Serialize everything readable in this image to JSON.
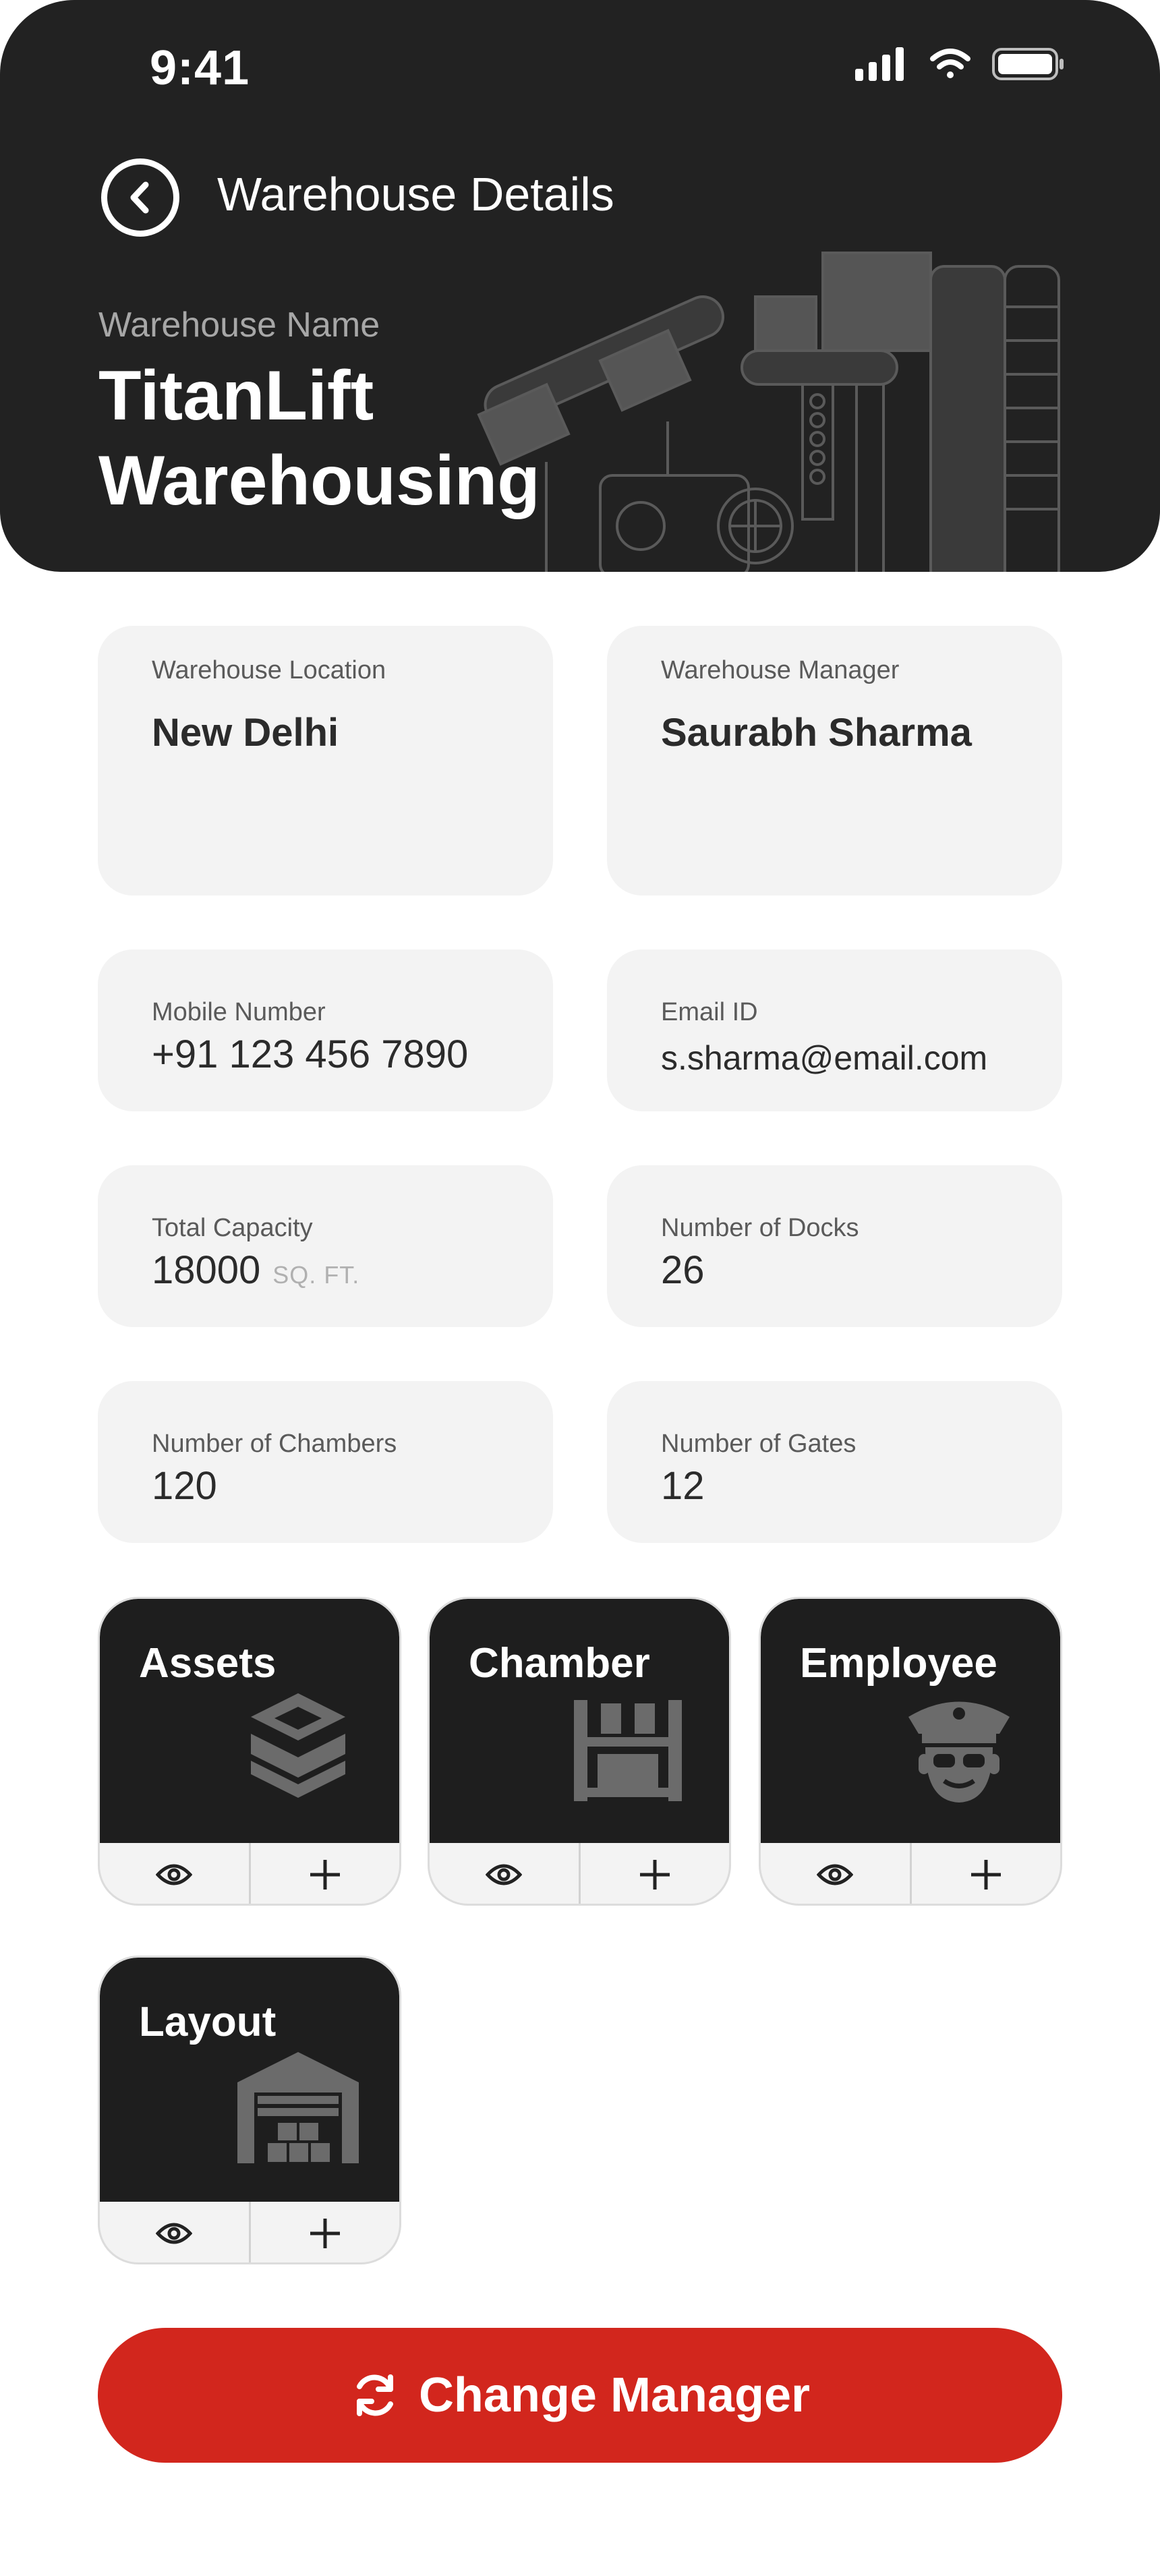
{
  "status": {
    "time": "9:41"
  },
  "header": {
    "title": "Warehouse Details",
    "name_label": "Warehouse Name",
    "name_line1": "TitanLift",
    "name_line2": "Warehousing"
  },
  "info": {
    "location": {
      "label": "Warehouse Location",
      "value": "New Delhi"
    },
    "manager": {
      "label": "Warehouse Manager",
      "value": "Saurabh Sharma"
    },
    "mobile": {
      "label": "Mobile Number",
      "value": "+91 123 456 7890"
    },
    "email": {
      "label": "Email ID",
      "value": "s.sharma@email.com"
    },
    "capacity": {
      "label": "Total Capacity",
      "value": "18000",
      "unit": "SQ. FT."
    },
    "docks": {
      "label": "Number of Docks",
      "value": "26"
    },
    "chambers": {
      "label": "Number of Chambers",
      "value": "120"
    },
    "gates": {
      "label": "Number of Gates",
      "value": "12"
    }
  },
  "tiles": {
    "assets": {
      "name": "Assets",
      "icon": "box-icon"
    },
    "chamber": {
      "name": "Chamber",
      "icon": "storage-rack-icon"
    },
    "employee": {
      "name": "Employee",
      "icon": "guard-icon"
    },
    "layout": {
      "name": "Layout",
      "icon": "warehouse-icon"
    }
  },
  "cta": {
    "label": "Change Manager",
    "icon": "refresh-icon"
  },
  "colors": {
    "header_bg": "#222222",
    "card_bg": "#f3f3f3",
    "accent_red": "#d2261d",
    "tile_bg": "#1e1e1e"
  }
}
